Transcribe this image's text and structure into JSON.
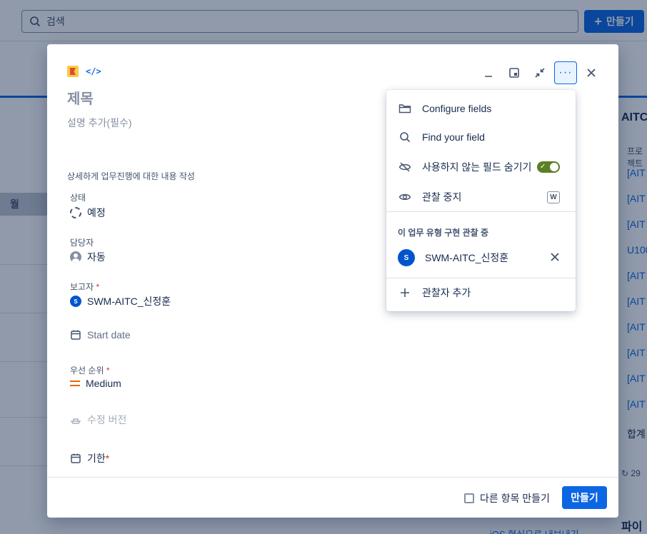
{
  "background": {
    "search_placeholder": "검색",
    "create_label": "만들기",
    "column_header": "월",
    "panel_title": "AITC",
    "panel_subheader": "프로젝트",
    "panel_items": [
      "[AIT",
      "[AIT",
      "[AIT",
      "U100",
      "[AIT",
      "[AIT",
      "[AIT",
      "[AIT",
      "[AIT",
      "[AIT"
    ],
    "panel_total": "합계",
    "panel_footer": "29",
    "panel2_title": "파이 ",
    "bottom_link": "iOS 형식으로 내보내기"
  },
  "modal": {
    "title": "제목",
    "description_placeholder": "설명 추가(필수)",
    "hint": "상세하게 업무진행에 대한 내용 작성",
    "fields": {
      "status": {
        "label": "상태",
        "value": "예정"
      },
      "assignee": {
        "label": "담당자",
        "value": "자동"
      },
      "reporter": {
        "label": "보고자",
        "required_mark": "*",
        "value": "SWM-AITC_신정훈",
        "avatar_initial": "S"
      },
      "start_date": {
        "value": "Start date"
      },
      "priority": {
        "label": "우선 순위",
        "required_mark": "*",
        "value": "Medium"
      },
      "fix_version": {
        "value": "수정 버전"
      },
      "due_date": {
        "value": "기한",
        "required_mark": "*"
      }
    },
    "footer": {
      "create_another_label": "다른 항목 만들기",
      "create_another_checked": false,
      "create_button": "만들기"
    }
  },
  "menu": {
    "items": {
      "configure": "Configure fields",
      "find": "Find your field",
      "hide_unused": "사용하지 않는 필드 숨기기",
      "hide_unused_on": true,
      "stop_watching": "관찰 중지",
      "stop_watching_shortcut": "W"
    },
    "section_title": "이 업무 유형 구현 관찰 중",
    "watcher": {
      "name": "SWM-AITC_신정훈",
      "initial": "S"
    },
    "add_watcher": "관찰자 추가"
  },
  "colors": {
    "accent": "#0c66e4",
    "toggle_on": "#5b7f24",
    "priority_medium": "#e56910",
    "required": "#c9372c"
  }
}
